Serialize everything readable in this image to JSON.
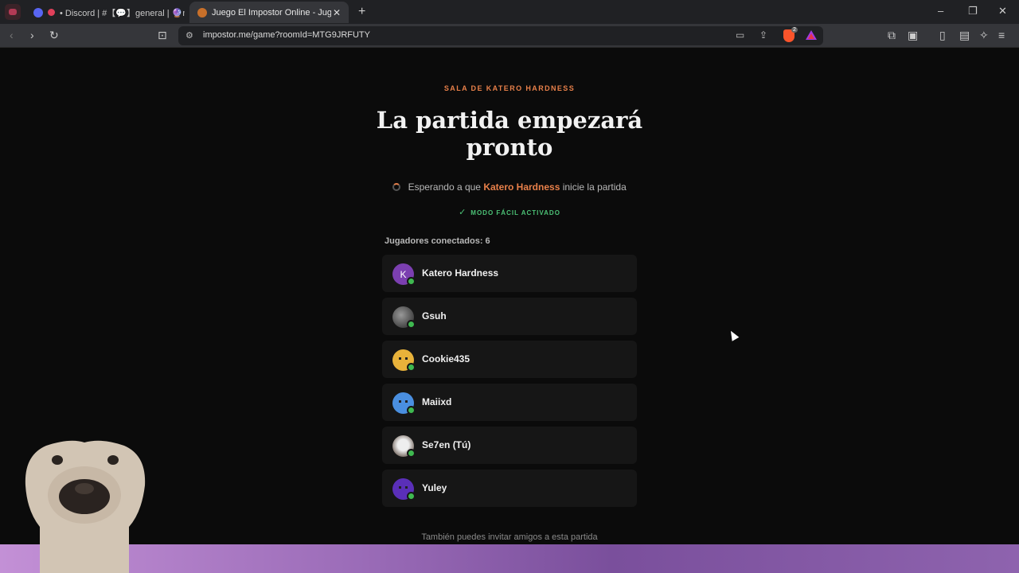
{
  "browser": {
    "tabs": [
      {
        "label": "• Discord | #【💬】general | 🔮n't",
        "active": false
      },
      {
        "label": "Juego El Impostor Online - Jugar",
        "active": true
      }
    ],
    "url": "impostor.me/game?roomId=MTG9JRFUTY",
    "brave_badge": "2"
  },
  "room": {
    "subtitle": "SALA DE KATERO HARDNESS",
    "title": "La partida empezará pronto",
    "waiting_prefix": "Esperando a que",
    "host_name": "Katero Hardness",
    "waiting_suffix": "inicie la partida",
    "easy_mode": "MODO FÁCIL ACTIVADO",
    "players_label": "Jugadores conectados: 6",
    "invite_text": "También puedes invitar amigos a esta partida"
  },
  "players": [
    {
      "name": "Katero Hardness",
      "avatar": "initial-k",
      "initial": "K",
      "color": "#7b3fb0"
    },
    {
      "name": "Gsuh",
      "avatar": "grey-photo",
      "color": "#444444"
    },
    {
      "name": "Cookie435",
      "avatar": "yellow-face",
      "color": "#e8b23a"
    },
    {
      "name": "Maiixd",
      "avatar": "blue-face",
      "color": "#4a8fe0"
    },
    {
      "name": "Se7en (Tú)",
      "avatar": "pug-photo",
      "color": "#d8d0c8"
    },
    {
      "name": "Yuley",
      "avatar": "purple-face",
      "color": "#5a2fb8"
    }
  ],
  "colors": {
    "accent": "#e8804a",
    "online": "#3fb950",
    "easy": "#4cc276"
  }
}
